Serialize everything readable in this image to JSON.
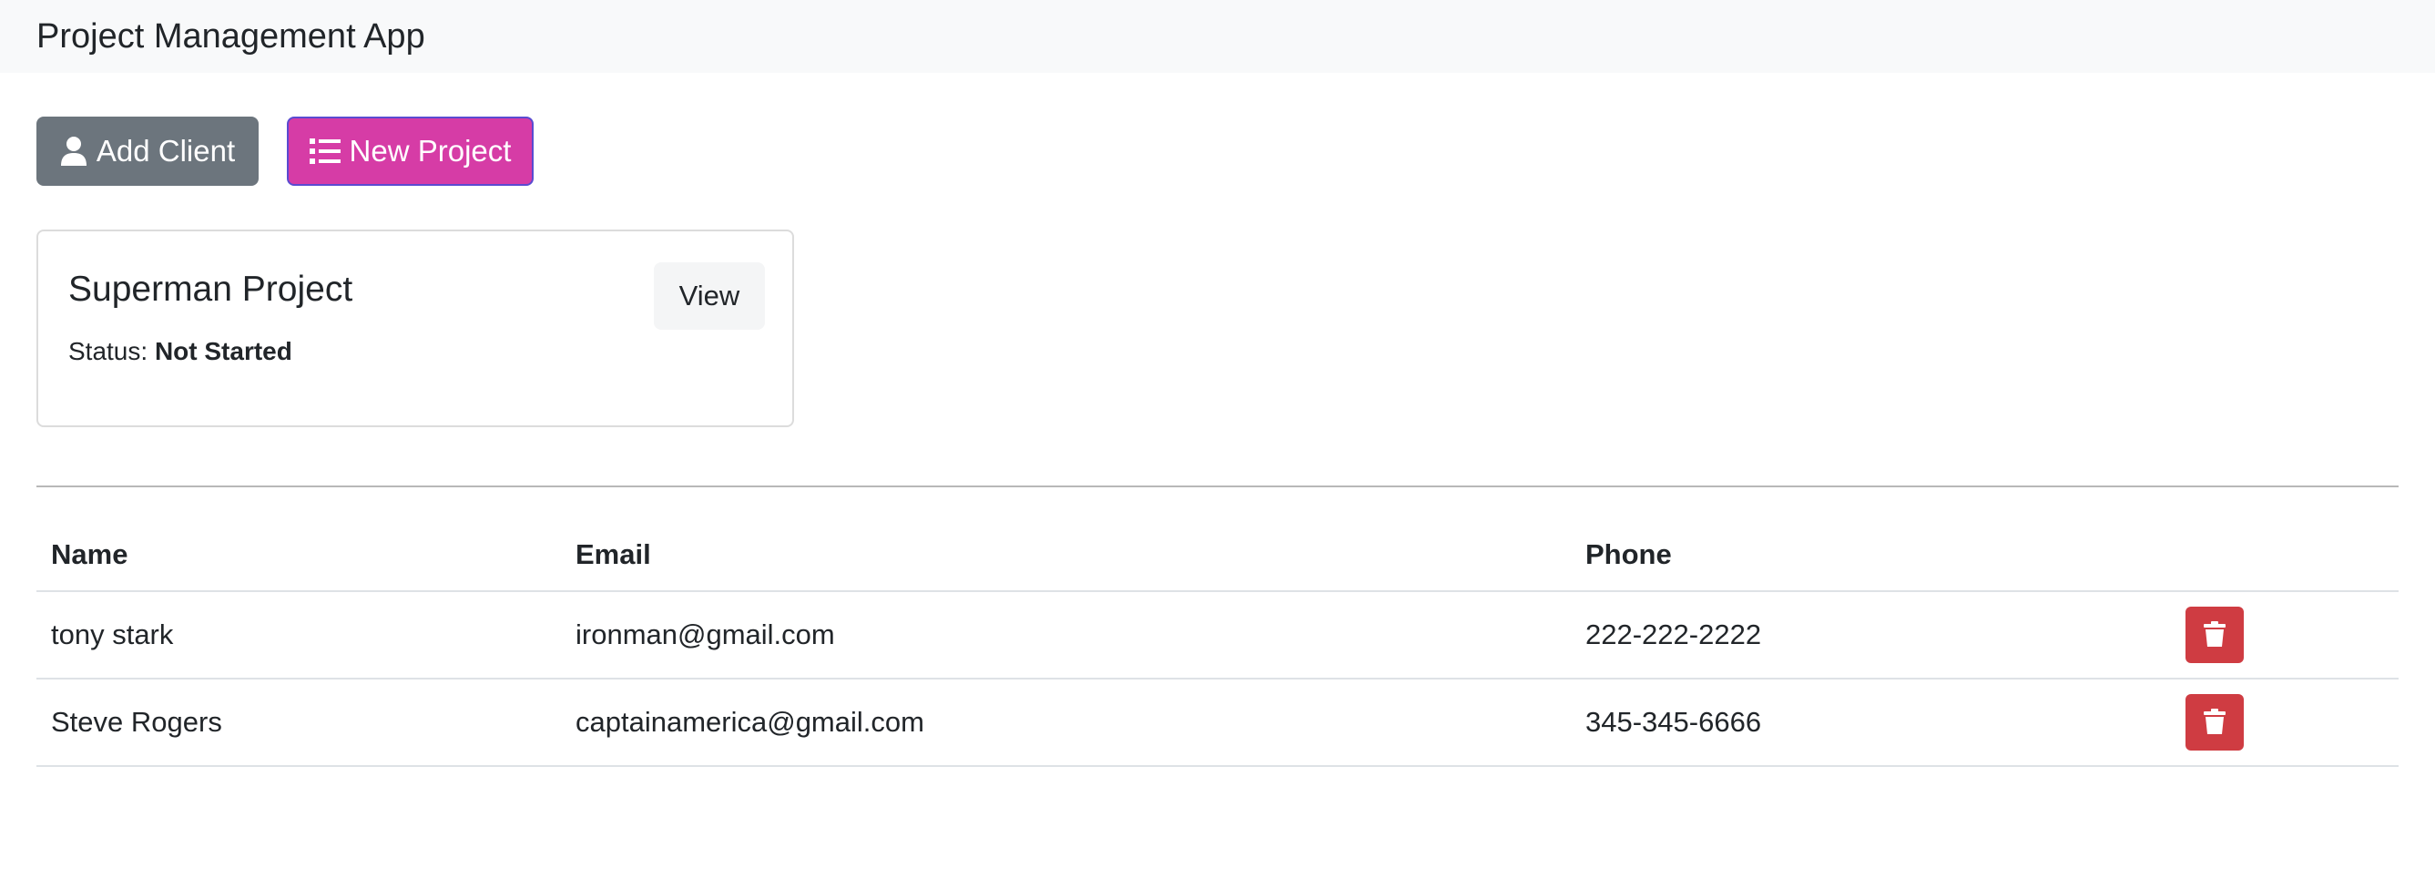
{
  "navbar": {
    "brand": "Project Management App"
  },
  "actions": {
    "add_client_label": "Add Client",
    "new_project_label": "New Project"
  },
  "projects": [
    {
      "name": "Superman Project",
      "status_label": "Status:",
      "status": "Not Started",
      "view_label": "View"
    }
  ],
  "clients_table": {
    "headers": {
      "name": "Name",
      "email": "Email",
      "phone": "Phone"
    },
    "rows": [
      {
        "name": "tony stark",
        "email": "ironman@gmail.com",
        "phone": "222-222-2222"
      },
      {
        "name": "Steve Rogers",
        "email": "captainamerica@gmail.com",
        "phone": "345-345-6666"
      }
    ]
  },
  "colors": {
    "add_client_bg": "#6c757d",
    "new_project_bg": "#d63ca6",
    "delete_bg": "#cf3c42",
    "navbar_bg": "#f8f9fa"
  },
  "icons": {
    "add_client": "user-icon",
    "new_project": "list-icon",
    "delete": "trash-icon"
  }
}
